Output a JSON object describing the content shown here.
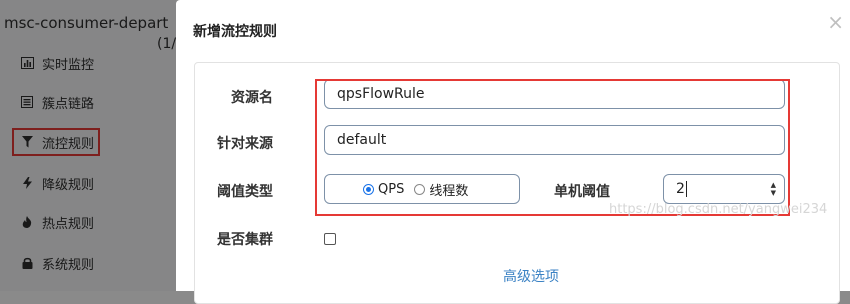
{
  "sidebar": {
    "app_title": "msc-consumer-depart",
    "app_sub": "(1/",
    "items": [
      {
        "label": "实时监控",
        "icon": "bar-chart-icon"
      },
      {
        "label": "簇点链路",
        "icon": "list-icon"
      },
      {
        "label": "流控规则",
        "icon": "filter-icon",
        "active": true
      },
      {
        "label": "降级规则",
        "icon": "bolt-icon"
      },
      {
        "label": "热点规则",
        "icon": "fire-icon"
      },
      {
        "label": "系统规则",
        "icon": "lock-icon"
      }
    ]
  },
  "modal": {
    "title": "新增流控规则",
    "close_label": "×",
    "form": {
      "resource_label": "资源名",
      "resource_value": "qpsFlowRule",
      "origin_label": "针对来源",
      "origin_value": "default",
      "threshold_type_label": "阈值类型",
      "threshold_type_options": [
        "QPS",
        "线程数"
      ],
      "threshold_type_selected": "QPS",
      "single_threshold_label": "单机阈值",
      "single_threshold_value": "2",
      "cluster_label": "是否集群",
      "cluster_checked": false,
      "advanced_label": "高级选项"
    }
  },
  "watermark": "https://blog.csdn.net/yangwei234",
  "colors": {
    "highlight": "#e53935",
    "accent": "#1a73e8",
    "link": "#3b82c4"
  }
}
